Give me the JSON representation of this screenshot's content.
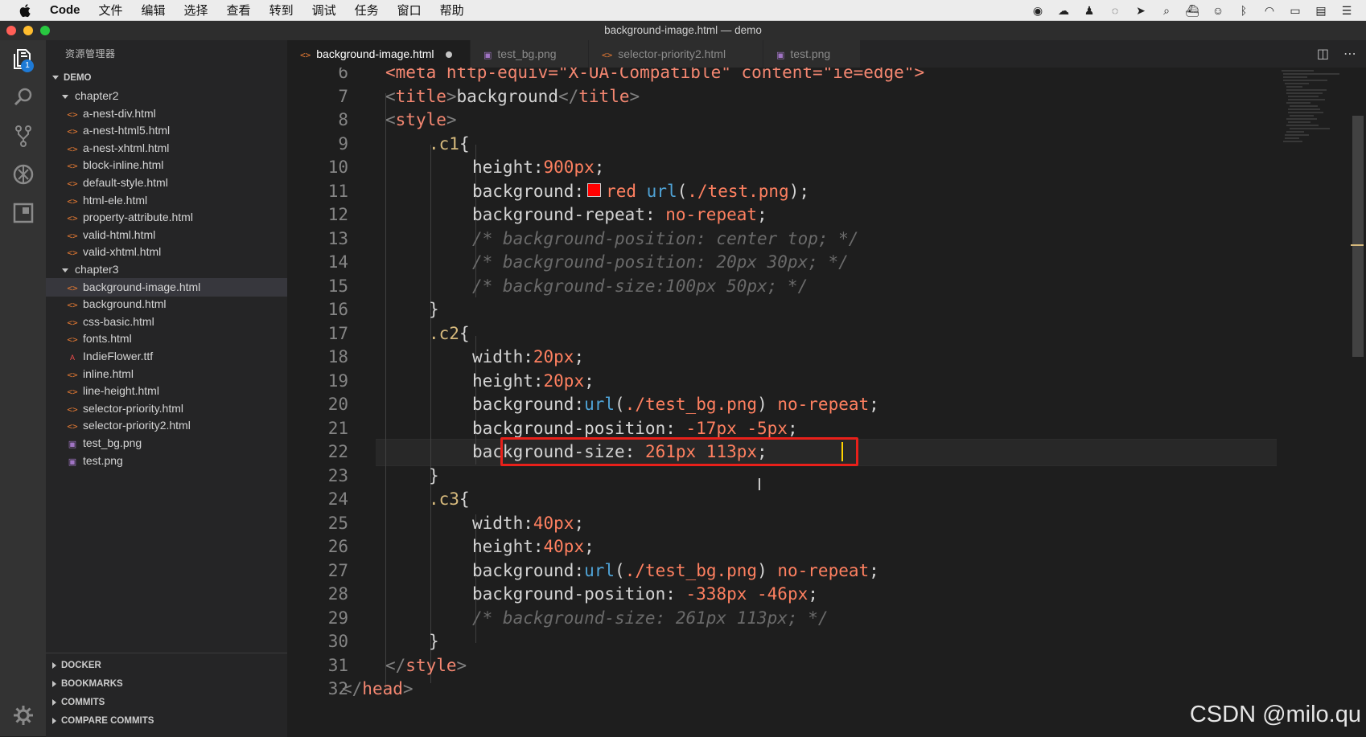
{
  "menubar": {
    "app": "Code",
    "items": [
      "文件",
      "编辑",
      "选择",
      "查看",
      "转到",
      "调试",
      "任务",
      "窗口",
      "帮助"
    ]
  },
  "window": {
    "title": "background-image.html — demo"
  },
  "activity_bar": {
    "explorer_badge": "1"
  },
  "sidebar": {
    "title": "资源管理器",
    "root": "DEMO",
    "folders": [
      {
        "name": "chapter2",
        "files": [
          {
            "name": "a-nest-div.html",
            "type": "html"
          },
          {
            "name": "a-nest-html5.html",
            "type": "html"
          },
          {
            "name": "a-nest-xhtml.html",
            "type": "html"
          },
          {
            "name": "block-inline.html",
            "type": "html"
          },
          {
            "name": "default-style.html",
            "type": "html"
          },
          {
            "name": "html-ele.html",
            "type": "html"
          },
          {
            "name": "property-attribute.html",
            "type": "html"
          },
          {
            "name": "valid-html.html",
            "type": "html"
          },
          {
            "name": "valid-xhtml.html",
            "type": "html"
          }
        ]
      },
      {
        "name": "chapter3",
        "files": [
          {
            "name": "background-image.html",
            "type": "html",
            "selected": true
          },
          {
            "name": "background.html",
            "type": "html"
          },
          {
            "name": "css-basic.html",
            "type": "html"
          },
          {
            "name": "fonts.html",
            "type": "html"
          },
          {
            "name": "IndieFlower.ttf",
            "type": "ttf"
          },
          {
            "name": "inline.html",
            "type": "html"
          },
          {
            "name": "line-height.html",
            "type": "html"
          },
          {
            "name": "selector-priority.html",
            "type": "html"
          },
          {
            "name": "selector-priority2.html",
            "type": "html"
          },
          {
            "name": "test_bg.png",
            "type": "png"
          },
          {
            "name": "test.png",
            "type": "png"
          }
        ]
      }
    ],
    "bottom_sections": [
      "DOCKER",
      "BOOKMARKS",
      "COMMITS",
      "COMPARE COMMITS"
    ]
  },
  "tabs": [
    {
      "label": "background-image.html",
      "type": "html",
      "active": true,
      "dirty": true
    },
    {
      "label": "test_bg.png",
      "type": "png"
    },
    {
      "label": "selector-priority2.html",
      "type": "html"
    },
    {
      "label": "test.png",
      "type": "png"
    }
  ],
  "editor": {
    "lines": [
      {
        "n": "6",
        "indent": 1,
        "tokens": [
          [
            "t-tag",
            "<meta http-equiv=\"X-UA-Compatible\" content=\"ie=edge\">"
          ]
        ]
      },
      {
        "n": "7",
        "indent": 1,
        "tokens": [
          [
            "t-br",
            "<"
          ],
          [
            "t-tag",
            "title"
          ],
          [
            "t-br",
            ">"
          ],
          [
            "t-plain",
            "background"
          ],
          [
            "t-br",
            "</"
          ],
          [
            "t-tag",
            "title"
          ],
          [
            "t-br",
            ">"
          ]
        ]
      },
      {
        "n": "8",
        "indent": 1,
        "tokens": [
          [
            "t-br",
            "<"
          ],
          [
            "t-tag",
            "style"
          ],
          [
            "t-br",
            ">"
          ]
        ]
      },
      {
        "n": "9",
        "indent": 2,
        "tokens": [
          [
            "t-sel",
            ".c1"
          ],
          [
            "t-plain",
            "{"
          ]
        ]
      },
      {
        "n": "10",
        "indent": 3,
        "tokens": [
          [
            "t-prop",
            "height"
          ],
          [
            "t-plain",
            ":"
          ],
          [
            "t-num",
            "900px"
          ],
          [
            "t-plain",
            ";"
          ]
        ]
      },
      {
        "n": "11",
        "indent": 3,
        "tokens": [
          [
            "t-prop",
            "background"
          ],
          [
            "t-plain",
            ":"
          ],
          [
            "swatch",
            ""
          ],
          [
            "t-kw",
            "red "
          ],
          [
            "t-fn",
            "url"
          ],
          [
            "t-plain",
            "("
          ],
          [
            "t-str",
            "./test.png"
          ],
          [
            "t-plain",
            ");"
          ]
        ]
      },
      {
        "n": "12",
        "indent": 3,
        "tokens": [
          [
            "t-prop",
            "background-repeat"
          ],
          [
            "t-plain",
            ": "
          ],
          [
            "t-kw",
            "no-repeat"
          ],
          [
            "t-plain",
            ";"
          ]
        ]
      },
      {
        "n": "13",
        "indent": 3,
        "tokens": [
          [
            "t-com",
            "/* background-position: center top; */"
          ]
        ]
      },
      {
        "n": "14",
        "indent": 3,
        "tokens": [
          [
            "t-com",
            "/* background-position: 20px 30px; */"
          ]
        ]
      },
      {
        "n": "15",
        "indent": 3,
        "tokens": [
          [
            "t-com",
            "/* background-size:100px 50px; */"
          ]
        ]
      },
      {
        "n": "16",
        "indent": 2,
        "tokens": [
          [
            "t-plain",
            "}"
          ]
        ]
      },
      {
        "n": "17",
        "indent": 2,
        "tokens": [
          [
            "t-sel",
            ".c2"
          ],
          [
            "t-plain",
            "{"
          ]
        ]
      },
      {
        "n": "18",
        "indent": 3,
        "tokens": [
          [
            "t-prop",
            "width"
          ],
          [
            "t-plain",
            ":"
          ],
          [
            "t-num",
            "20px"
          ],
          [
            "t-plain",
            ";"
          ]
        ]
      },
      {
        "n": "19",
        "indent": 3,
        "tokens": [
          [
            "t-prop",
            "height"
          ],
          [
            "t-plain",
            ":"
          ],
          [
            "t-num",
            "20px"
          ],
          [
            "t-plain",
            ";"
          ]
        ]
      },
      {
        "n": "20",
        "indent": 3,
        "tokens": [
          [
            "t-prop",
            "background"
          ],
          [
            "t-plain",
            ":"
          ],
          [
            "t-fn",
            "url"
          ],
          [
            "t-plain",
            "("
          ],
          [
            "t-str",
            "./test_bg.png"
          ],
          [
            "t-plain",
            ") "
          ],
          [
            "t-kw",
            "no-repeat"
          ],
          [
            "t-plain",
            ";"
          ]
        ]
      },
      {
        "n": "21",
        "indent": 3,
        "tokens": [
          [
            "t-prop",
            "background-position"
          ],
          [
            "t-plain",
            ": "
          ],
          [
            "t-num",
            "-17px -5px"
          ],
          [
            "t-plain",
            ";"
          ]
        ]
      },
      {
        "n": "22",
        "indent": 3,
        "tokens": [
          [
            "t-prop",
            "background-size"
          ],
          [
            "t-plain",
            ": "
          ],
          [
            "t-num",
            "261px 113px"
          ],
          [
            "t-plain",
            ";"
          ]
        ]
      },
      {
        "n": "23",
        "indent": 2,
        "tokens": [
          [
            "t-plain",
            "}"
          ]
        ]
      },
      {
        "n": "24",
        "indent": 2,
        "tokens": [
          [
            "t-sel",
            ".c3"
          ],
          [
            "t-plain",
            "{"
          ]
        ]
      },
      {
        "n": "25",
        "indent": 3,
        "tokens": [
          [
            "t-prop",
            "width"
          ],
          [
            "t-plain",
            ":"
          ],
          [
            "t-num",
            "40px"
          ],
          [
            "t-plain",
            ";"
          ]
        ]
      },
      {
        "n": "26",
        "indent": 3,
        "tokens": [
          [
            "t-prop",
            "height"
          ],
          [
            "t-plain",
            ":"
          ],
          [
            "t-num",
            "40px"
          ],
          [
            "t-plain",
            ";"
          ]
        ]
      },
      {
        "n": "27",
        "indent": 3,
        "tokens": [
          [
            "t-prop",
            "background"
          ],
          [
            "t-plain",
            ":"
          ],
          [
            "t-fn",
            "url"
          ],
          [
            "t-plain",
            "("
          ],
          [
            "t-str",
            "./test_bg.png"
          ],
          [
            "t-plain",
            ") "
          ],
          [
            "t-kw",
            "no-repeat"
          ],
          [
            "t-plain",
            ";"
          ]
        ]
      },
      {
        "n": "28",
        "indent": 3,
        "tokens": [
          [
            "t-prop",
            "background-position"
          ],
          [
            "t-plain",
            ": "
          ],
          [
            "t-num",
            "-338px -46px"
          ],
          [
            "t-plain",
            ";"
          ]
        ]
      },
      {
        "n": "29",
        "indent": 3,
        "tokens": [
          [
            "t-com",
            "/* background-size: 261px 113px; */"
          ]
        ]
      },
      {
        "n": "30",
        "indent": 2,
        "tokens": [
          [
            "t-plain",
            "}"
          ]
        ]
      },
      {
        "n": "31",
        "indent": 1,
        "tokens": [
          [
            "t-br",
            "</"
          ],
          [
            "t-tag",
            "style"
          ],
          [
            "t-br",
            ">"
          ]
        ]
      },
      {
        "n": "32",
        "indent": 0,
        "tokens": [
          [
            "t-br",
            "</"
          ],
          [
            "t-tag",
            "head"
          ],
          [
            "t-br",
            ">"
          ]
        ]
      }
    ]
  },
  "watermark": "CSDN @milo.qu"
}
